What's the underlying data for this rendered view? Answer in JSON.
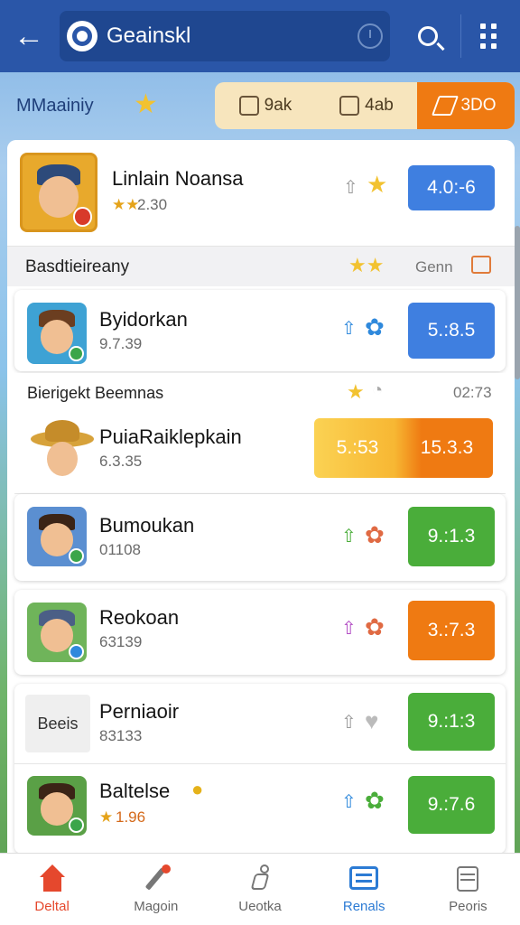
{
  "header": {
    "search_text": "Geainskl",
    "back_icon": "arrow-left-icon",
    "search_icon": "search-icon",
    "menu_icon": "grid-menu-icon"
  },
  "sort": {
    "label": "MMaainiy",
    "segments": [
      {
        "label": "9ak",
        "active": false
      },
      {
        "label": "4ab",
        "active": false
      },
      {
        "label": "3DO",
        "active": true
      }
    ]
  },
  "featured": {
    "name": "Linlain Noansa",
    "meta": "2.30",
    "stars": "★★",
    "score": "4.0:-6",
    "score_color": "#3f7fe0"
  },
  "section1": {
    "label": "Basdtieireany",
    "right": "Genn"
  },
  "section2": {
    "label": "Bierigekt Beemnas",
    "right": "02:73"
  },
  "players": [
    {
      "name": "Byidorkan",
      "meta": "9.7.39",
      "score": "5.:8.5",
      "color": "#3f7fe0"
    },
    {
      "name": "PuiaRaiklepkain",
      "meta": "6.3.35",
      "score_a": "5.:53",
      "score_b": "15.3.3",
      "color": "#ef7a12"
    },
    {
      "name": "Bumoukan",
      "meta": "01108",
      "score": "9.:1.3",
      "color": "#4aad3a"
    },
    {
      "name": "Reokoan",
      "meta": "63139",
      "score": "3.:7.3",
      "color": "#ef7a12"
    },
    {
      "name": "Perniaoir",
      "meta": "83133",
      "score": "9.:1:3",
      "color": "#4aad3a",
      "thumb_text": "Beeis"
    },
    {
      "name": "Baltelse",
      "meta": "1.96",
      "meta_prefix": "★",
      "score": "9.:7.6",
      "color": "#4aad3a"
    }
  ],
  "nav": [
    {
      "label": "Deltal",
      "icon": "home-icon"
    },
    {
      "label": "Magoin",
      "icon": "pencil-icon"
    },
    {
      "label": "Ueotka",
      "icon": "runner-icon"
    },
    {
      "label": "Renals",
      "icon": "list-icon"
    },
    {
      "label": "Peoris",
      "icon": "stack-icon"
    }
  ]
}
